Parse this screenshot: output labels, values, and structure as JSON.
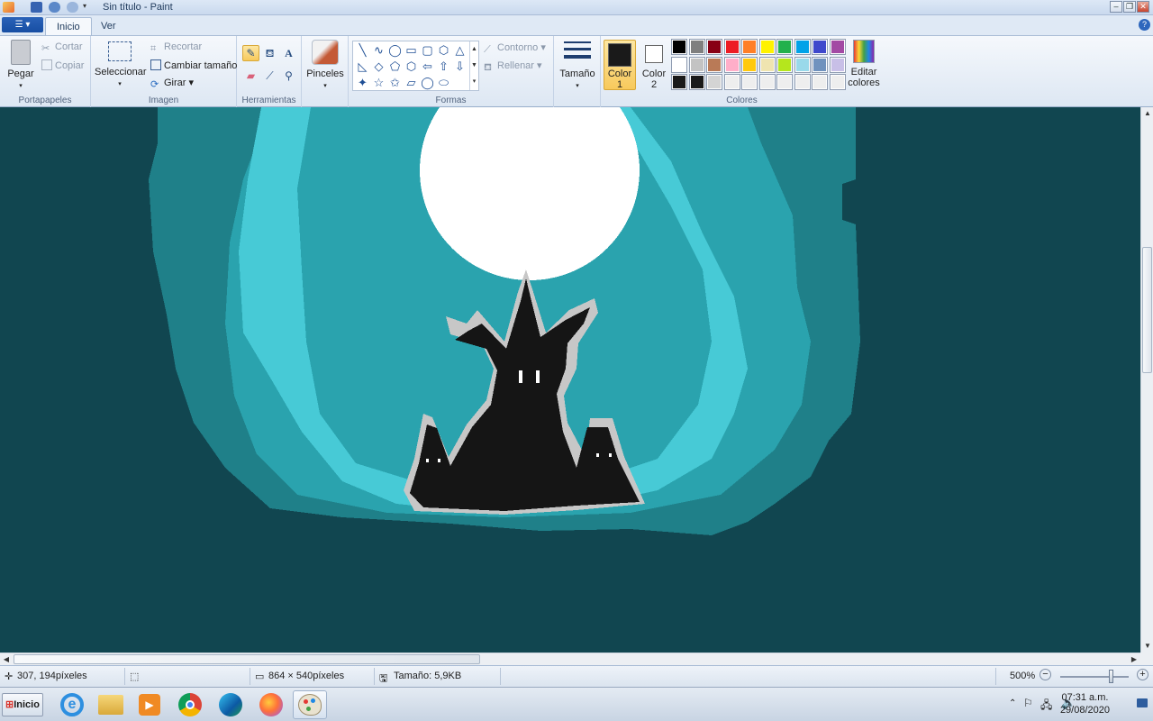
{
  "window": {
    "title": "Sin título - Paint"
  },
  "tabs": {
    "file_icon": "menu-icon",
    "inicio": "Inicio",
    "ver": "Ver"
  },
  "ribbon": {
    "clipboard": {
      "label": "Portapapeles",
      "paste": "Pegar",
      "cut": "Cortar",
      "copy": "Copiar"
    },
    "image": {
      "label": "Imagen",
      "select": "Seleccionar",
      "crop": "Recortar",
      "resize": "Cambiar tamaño",
      "rotate": "Girar"
    },
    "tools": {
      "label": "Herramientas",
      "brushes": "Pinceles"
    },
    "shapes": {
      "label": "Formas",
      "outline": "Contorno",
      "fill": "Rellenar",
      "glyphs": [
        "╲",
        "∿",
        "◯",
        "▭",
        "▢",
        "⬡",
        "△",
        "◺",
        "◇",
        "⬠",
        "⬡",
        "⇦",
        "⇧",
        "⇩",
        "✦",
        "☆",
        "✩",
        "▱",
        "◯",
        "⬭"
      ]
    },
    "size": {
      "label": "Tamaño"
    },
    "colors": {
      "label": "Colores",
      "color1": "Color\n1",
      "color1_line1": "Color",
      "color1_line2": "1",
      "color2_line1": "Color",
      "color2_line2": "2",
      "edit_line1": "Editar",
      "edit_line2": "colores",
      "color1_value": "#1a1a1a",
      "color2_value": "#ffffff",
      "palette": [
        [
          "#000000",
          "#7f7f7f",
          "#880015",
          "#ed1c24",
          "#ff7f27",
          "#fff200",
          "#22b14c",
          "#00a2e8",
          "#3f48cc",
          "#a349a4"
        ],
        [
          "#ffffff",
          "#c3c3c3",
          "#b97a57",
          "#ffaec9",
          "#ffc90e",
          "#efe4b0",
          "#b5e61d",
          "#99d9ea",
          "#7092be",
          "#c8bfe7"
        ],
        [
          "#1a1a1a",
          "#1a1a1a",
          "#d4d4d4",
          "#eeeeee",
          "#eeeeee",
          "#eeeeee",
          "#eeeeee",
          "#eeeeee",
          "#eeeeee",
          "#eeeeee"
        ]
      ]
    }
  },
  "status": {
    "cursor": "307, 194píxeles",
    "image_size": "864 × 540píxeles",
    "file_size": "Tamaño: 5,9KB",
    "zoom": "500%"
  },
  "taskbar": {
    "start": "Inicio",
    "apps": [
      "internet-explorer-icon",
      "file-explorer-icon",
      "media-player-icon",
      "chrome-icon",
      "edge-icon",
      "firefox-icon",
      "paint-icon"
    ],
    "time": "07:31 a.m.",
    "date": "29/08/2020"
  }
}
